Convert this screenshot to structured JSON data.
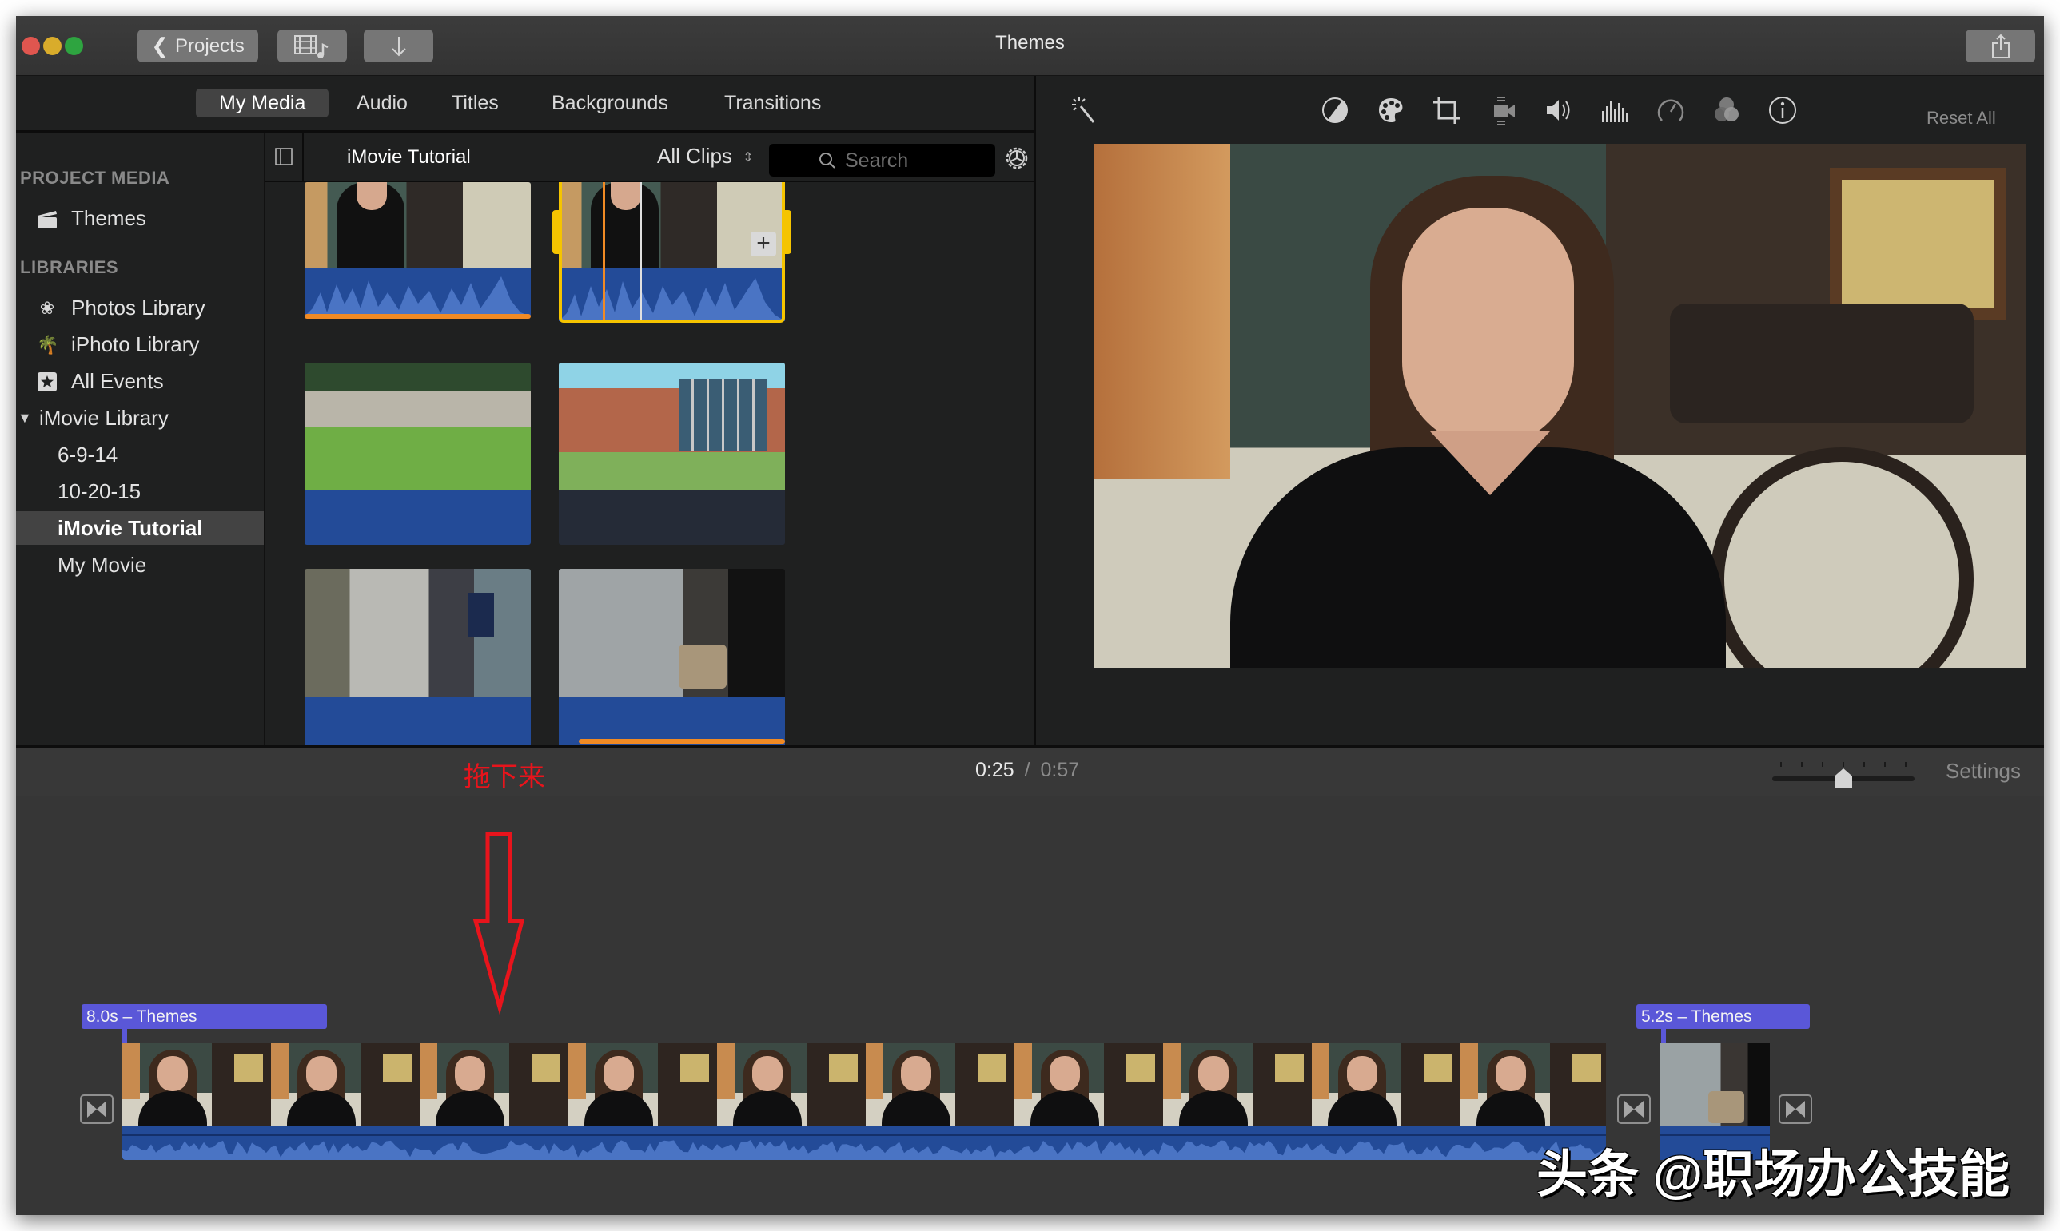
{
  "window": {
    "title": "Themes",
    "toolbar": {
      "projects_label": "Projects",
      "media_toggle_icon": "film-music-icon",
      "import_icon": "download-arrow-icon",
      "share_icon": "share-icon"
    }
  },
  "tabs": [
    {
      "label": "My Media",
      "active": true
    },
    {
      "label": "Audio",
      "active": false
    },
    {
      "label": "Titles",
      "active": false
    },
    {
      "label": "Backgrounds",
      "active": false
    },
    {
      "label": "Transitions",
      "active": false
    }
  ],
  "sidebar": {
    "project_media_heading": "PROJECT MEDIA",
    "project_media_items": [
      {
        "label": "Themes",
        "icon": "clapperboard-icon"
      }
    ],
    "libraries_heading": "LIBRARIES",
    "library_items": [
      {
        "label": "Photos Library",
        "icon": "photos-flower-icon"
      },
      {
        "label": "iPhoto Library",
        "icon": "palm-tree-icon"
      },
      {
        "label": "All Events",
        "icon": "star-box-icon"
      }
    ],
    "imovie_library": {
      "label": "iMovie Library",
      "expanded": true,
      "children": [
        {
          "label": "6-9-14",
          "selected": false
        },
        {
          "label": "10-20-15",
          "selected": false
        },
        {
          "label": "iMovie Tutorial",
          "selected": true
        },
        {
          "label": "My Movie",
          "selected": false
        }
      ]
    }
  },
  "browser": {
    "title": "iMovie Tutorial",
    "filter": "All Clips",
    "search_placeholder": "Search",
    "clips": [
      {
        "name": "woman-interview-clip-1",
        "scene": "interview",
        "has_audio_wave": true,
        "used": true,
        "selected": false
      },
      {
        "name": "woman-interview-clip-2",
        "scene": "interview",
        "has_audio_wave": true,
        "used": false,
        "selected": true
      },
      {
        "name": "penn-state-sign-clip",
        "scene": "sign",
        "has_audio_wave": false,
        "used": false,
        "selected": false,
        "audio": true
      },
      {
        "name": "building-clip",
        "scene": "building",
        "has_audio_wave": false,
        "used": false,
        "selected": false,
        "audio": false
      },
      {
        "name": "foundry-workers-clip",
        "scene": "foundry",
        "has_audio_wave": false,
        "used": false,
        "selected": false,
        "audio": true
      },
      {
        "name": "foundry-closeup-clip",
        "scene": "closeup",
        "has_audio_wave": false,
        "used": true,
        "selected": false,
        "audio": true
      }
    ]
  },
  "viewer": {
    "reset_label": "Reset All",
    "tools": [
      "magic-wand-icon",
      "color-balance-icon",
      "color-palette-icon",
      "crop-icon",
      "stabilization-icon",
      "volume-icon",
      "equalizer-icon",
      "speed-icon",
      "clip-filter-icon",
      "info-icon"
    ]
  },
  "timeline": {
    "current_time": "0:25",
    "separator": "/",
    "total_time": "0:57",
    "settings_label": "Settings",
    "zoom_level": 0.5,
    "title_clips": [
      {
        "label": "8.0s – Themes"
      },
      {
        "label": "5.2s – Themes"
      }
    ]
  },
  "annotation": {
    "text": "拖下来",
    "color": "#e8141c"
  },
  "watermark": "头条 @职场办公技能",
  "colors": {
    "title_clip": "#5a57d8",
    "audio_blue": "#234b98",
    "wave_blue": "#4a74c4",
    "selection_yellow": "#f5c400",
    "used_orange": "#f08a24"
  }
}
